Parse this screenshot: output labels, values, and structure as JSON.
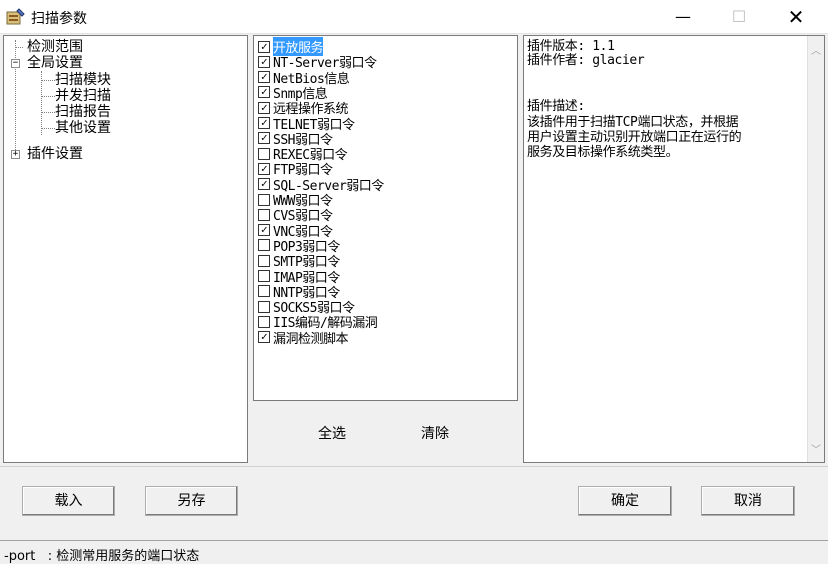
{
  "window": {
    "title": "扫描参数",
    "minimize_glyph": "—",
    "maximize_glyph": "☐",
    "close_glyph": "✕"
  },
  "tree": {
    "items": [
      {
        "label": "检测范围"
      },
      {
        "label": "全局设置",
        "expander": "−"
      },
      {
        "label": "扫描模块"
      },
      {
        "label": "并发扫描"
      },
      {
        "label": "扫描报告"
      },
      {
        "label": "其他设置"
      },
      {
        "label": "插件设置",
        "expander": "+"
      }
    ]
  },
  "modules": [
    {
      "label": "开放服务",
      "checked": true,
      "selected": true
    },
    {
      "label": "NT-Server弱口令",
      "checked": true
    },
    {
      "label": "NetBios信息",
      "checked": true
    },
    {
      "label": "Snmp信息",
      "checked": true
    },
    {
      "label": "远程操作系统",
      "checked": true
    },
    {
      "label": "TELNET弱口令",
      "checked": true
    },
    {
      "label": "SSH弱口令",
      "checked": true
    },
    {
      "label": "REXEC弱口令",
      "checked": false
    },
    {
      "label": "FTP弱口令",
      "checked": true
    },
    {
      "label": "SQL-Server弱口令",
      "checked": true
    },
    {
      "label": "WWW弱口令",
      "checked": false
    },
    {
      "label": "CVS弱口令",
      "checked": false
    },
    {
      "label": "VNC弱口令",
      "checked": true
    },
    {
      "label": "POP3弱口令",
      "checked": false
    },
    {
      "label": "SMTP弱口令",
      "checked": false
    },
    {
      "label": "IMAP弱口令",
      "checked": false
    },
    {
      "label": "NNTP弱口令",
      "checked": false
    },
    {
      "label": "SOCKS5弱口令",
      "checked": false
    },
    {
      "label": "IIS编码/解码漏洞",
      "checked": false
    },
    {
      "label": "漏洞检测脚本",
      "checked": true
    }
  ],
  "list_actions": {
    "select_all": "全选",
    "clear": "清除"
  },
  "plugin_info": {
    "version_line": "插件版本: 1.1",
    "author_line": "插件作者: glacier",
    "desc_heading": "插件描述:",
    "desc_lines": [
      "  该插件用于扫描TCP端口状态，并根据",
      "用户设置主动识别开放端口正在运行的",
      "服务及目标操作系统类型。"
    ]
  },
  "buttons": {
    "load": "载入",
    "save_as": "另存",
    "ok": "确定",
    "cancel": "取消"
  },
  "status": {
    "text": "-port   : 检测常用服务的端口状态"
  },
  "colors": {
    "selection": "#3399ff",
    "panel_bg": "#ffffff",
    "window_bg": "#f0f0f0"
  }
}
